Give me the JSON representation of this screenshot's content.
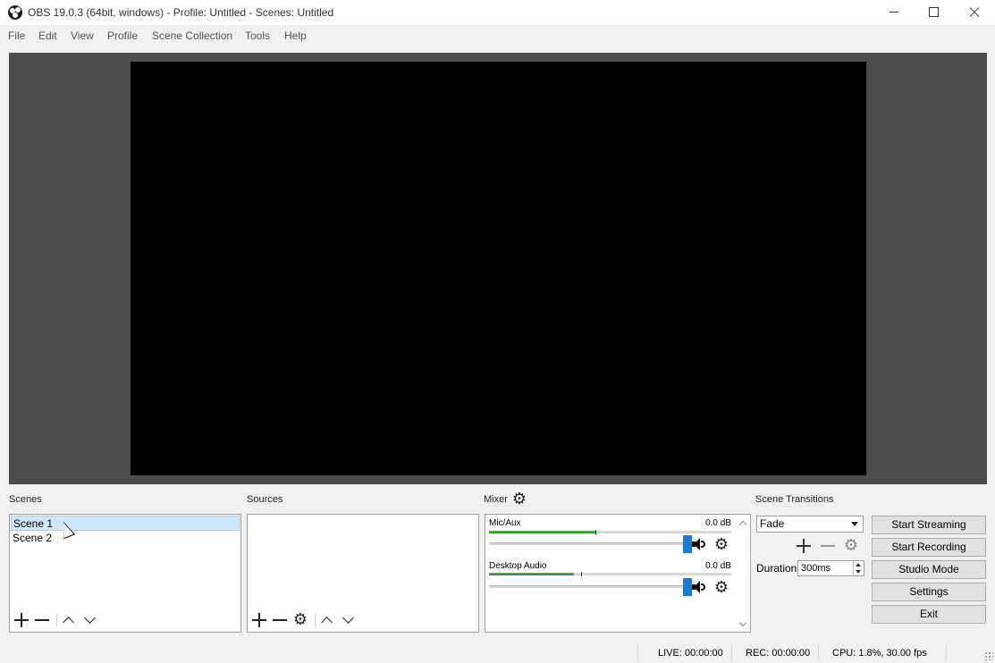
{
  "window": {
    "title": "OBS 19.0.3 (64bit, windows) - Profile: Untitled - Scenes: Untitled",
    "icon": "obs-logo-icon"
  },
  "menu": [
    "File",
    "Edit",
    "View",
    "Profile",
    "Scene Collection",
    "Tools",
    "Help"
  ],
  "docks": {
    "scenes": "Scenes",
    "sources": "Sources",
    "mixer": "Mixer",
    "transitions": "Scene Transitions"
  },
  "scenes": {
    "items": [
      "Scene 1",
      "Scene 2"
    ],
    "selected": "Scene 1"
  },
  "mixer": {
    "channels": [
      {
        "name": "Mic/Aux",
        "db": "0.0 dB",
        "level": 0.44,
        "peak": 0.44,
        "volume": 1.0
      },
      {
        "name": "Desktop Audio",
        "db": "0.0 dB",
        "level": 0.35,
        "peak": 0.38,
        "volume": 1.0
      }
    ]
  },
  "transitions": {
    "selected": "Fade",
    "duration_label": "Duration",
    "duration_value": "300ms"
  },
  "controls": {
    "start_streaming": "Start Streaming",
    "start_recording": "Start Recording",
    "studio_mode": "Studio Mode",
    "settings": "Settings",
    "exit": "Exit"
  },
  "status": {
    "live": "LIVE: 00:00:00",
    "rec": "REC: 00:00:00",
    "cpu": "CPU: 1.8%, 30.00 fps"
  },
  "colors": {
    "preview_bg": "#4c4c4c",
    "canvas": "#000000",
    "selection": "#cce8ff",
    "meter_green": "#3aa83a",
    "slider_handle": "#1979d4"
  }
}
